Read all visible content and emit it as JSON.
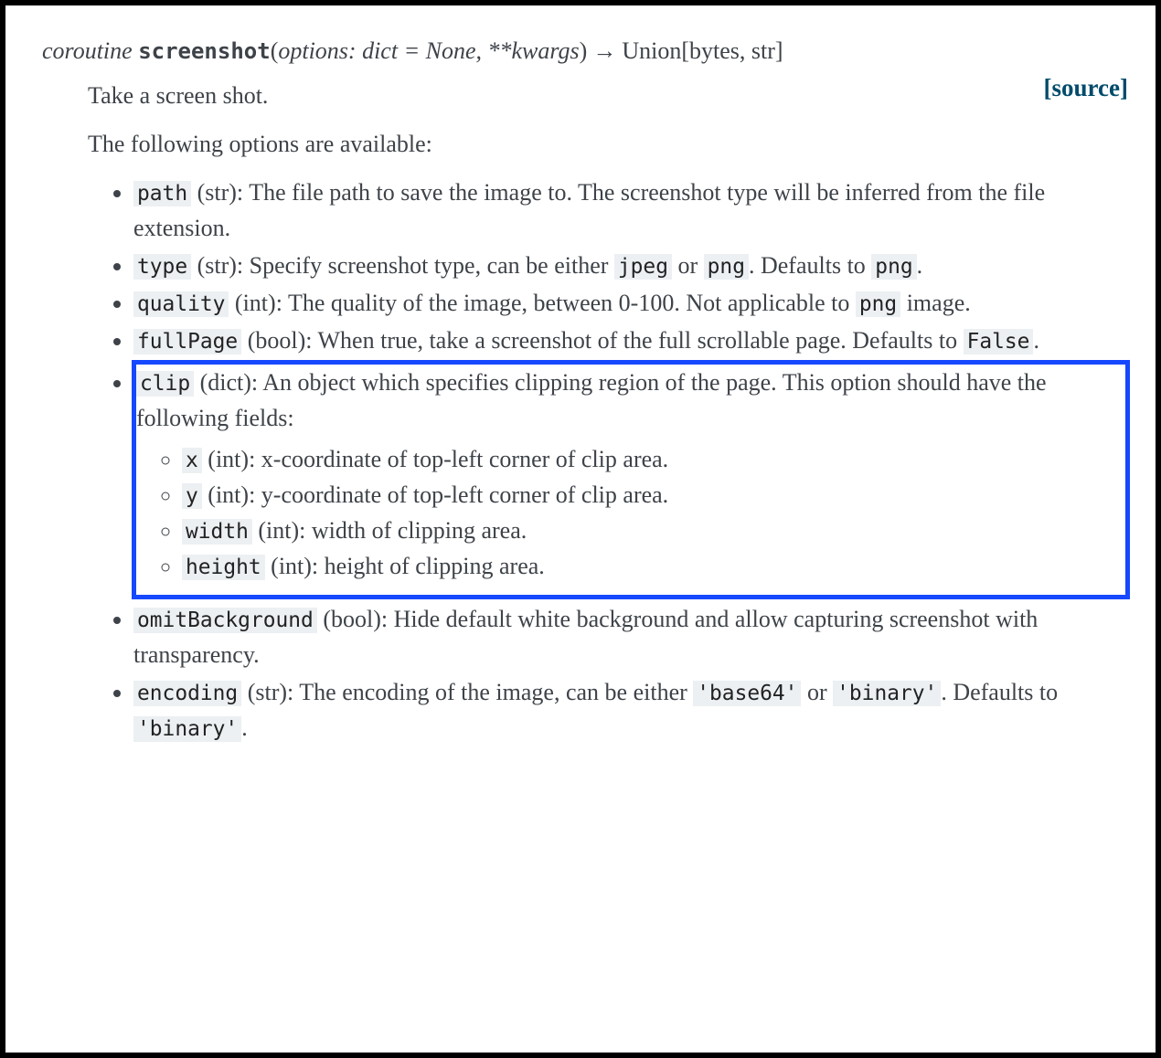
{
  "sig": {
    "prefix": "coroutine",
    "fname": "screenshot",
    "params_a": "options: dict",
    "params_b": " = None, **kwargs",
    "ret": "Union[bytes, str]"
  },
  "source": "[source]",
  "desc": "Take a screen shot.",
  "opts_intro": "The following options are available:",
  "options": {
    "path": {
      "name": "path",
      "type": "str",
      "desc": "The file path to save the image to. The screenshot type will be inferred from the file extension."
    },
    "type": {
      "name": "type",
      "type": "str",
      "desc_pre": "Specify screenshot type, can be either ",
      "v1": "jpeg",
      "mid": " or ",
      "v2": "png",
      "desc_post": ". Defaults to ",
      "def": "png",
      "tail": "."
    },
    "quality": {
      "name": "quality",
      "type": "int",
      "desc_pre": "The quality of the image, between 0-100. Not applicable to ",
      "v1": "png",
      "tail": " image."
    },
    "fullPage": {
      "name": "fullPage",
      "type": "bool",
      "desc_pre": "When true, take a screenshot of the full scrollable page. Defaults to ",
      "v1": "False",
      "tail": "."
    },
    "clip": {
      "name": "clip",
      "type": "dict",
      "desc": "An object which specifies clipping region of the page. This option should have the following fields:"
    },
    "omit": {
      "name": "omitBackground",
      "type": "bool",
      "desc": "Hide default white background and allow capturing screenshot with transparency."
    },
    "encoding": {
      "name": "encoding",
      "type": "str",
      "desc_pre": "The encoding of the image, can be either ",
      "v1": "'base64'",
      "mid": " or ",
      "v2": "'binary'",
      "desc_post": ". Defaults to ",
      "def": "'binary'",
      "tail": "."
    }
  },
  "clip_fields": {
    "x": {
      "name": "x",
      "type": "int",
      "desc": "x-coordinate of top-left corner of clip area."
    },
    "y": {
      "name": "y",
      "type": "int",
      "desc": "y-coordinate of top-left corner of clip area."
    },
    "width": {
      "name": "width",
      "type": "int",
      "desc": "width of clipping area."
    },
    "height": {
      "name": "height",
      "type": "int",
      "desc": "height of clipping area."
    }
  }
}
